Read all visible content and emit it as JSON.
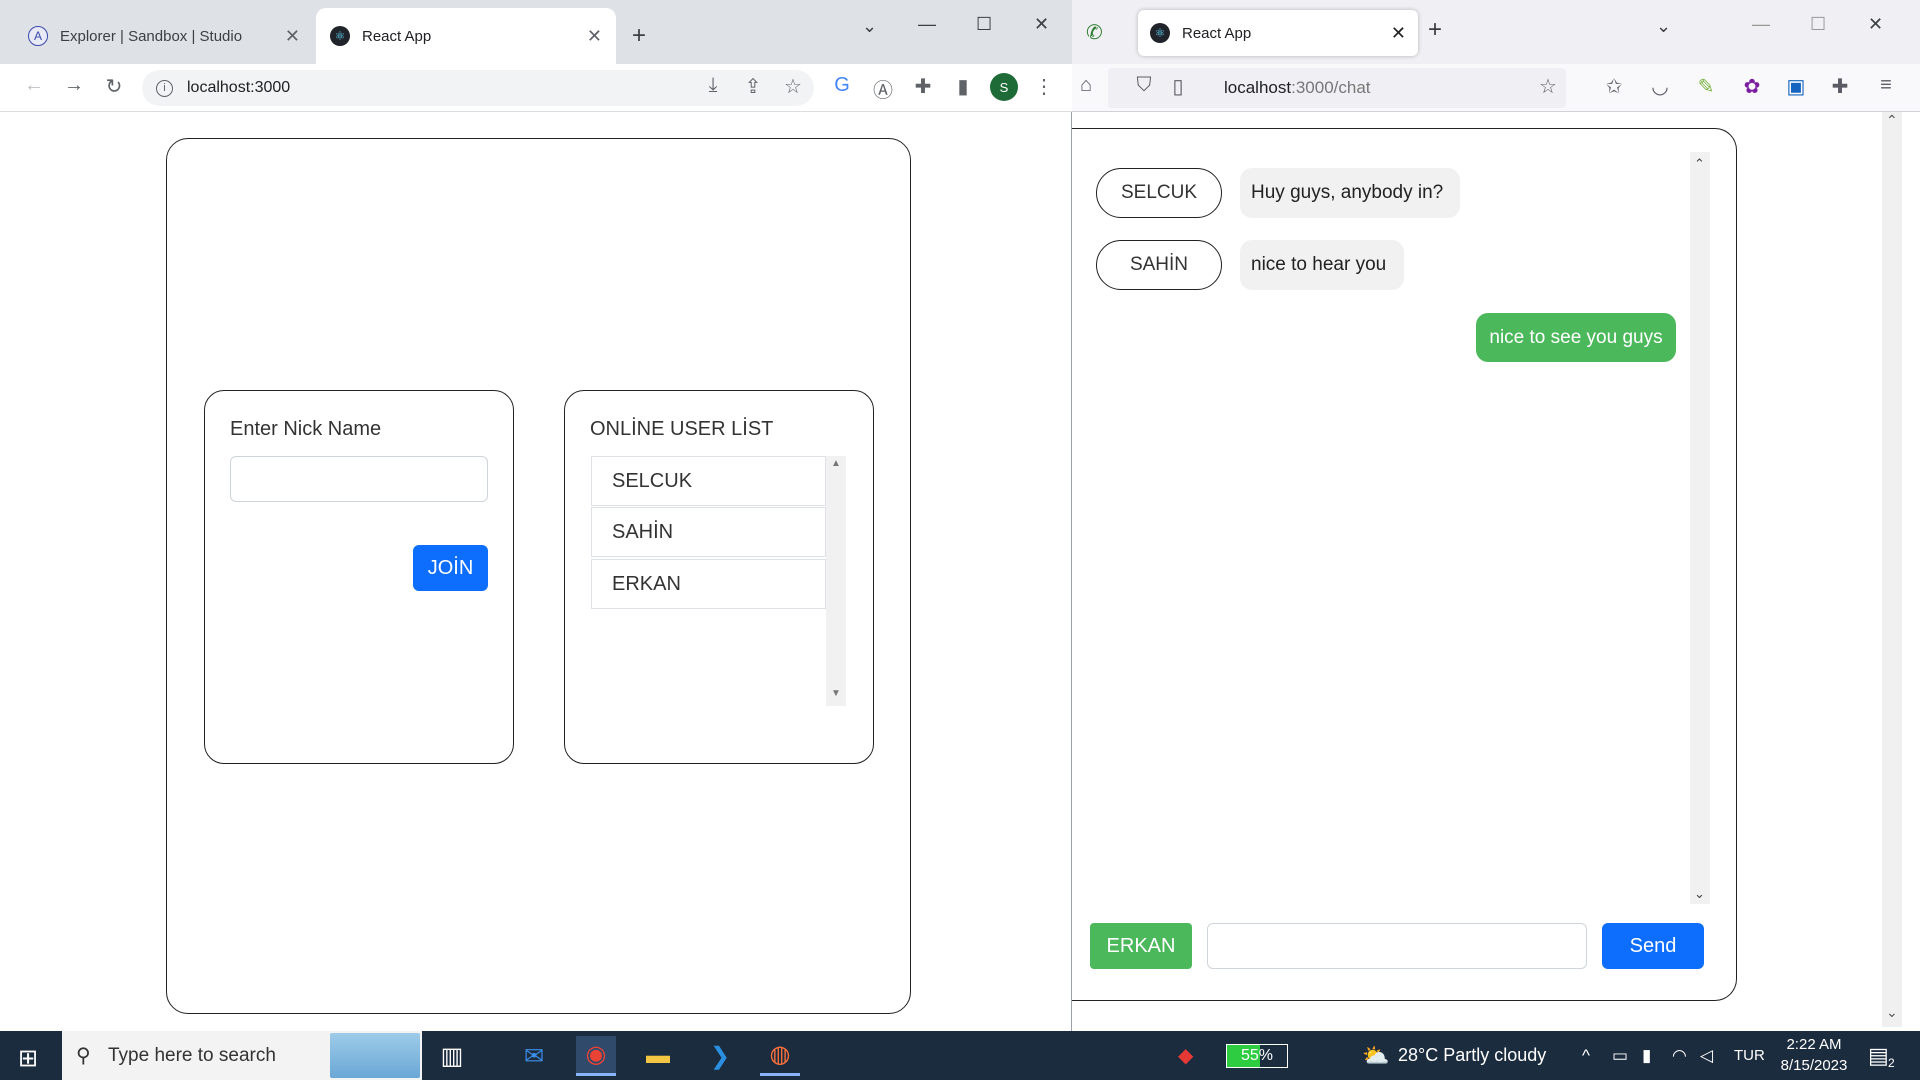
{
  "chrome": {
    "tabs": [
      {
        "label": "Explorer | Sandbox | Studio",
        "favicon": "A"
      },
      {
        "label": "React App"
      }
    ],
    "new_tab": "+",
    "url": "localhost:3000",
    "profile_initial": "S"
  },
  "login": {
    "nick_label": "Enter Nick Name",
    "nick_value": "",
    "join_label": "JOİN",
    "online_title": "ONLİNE USER LİST",
    "users": [
      "SELCUK",
      "SAHİN",
      "ERKAN"
    ]
  },
  "firefox": {
    "tab_label": "React App",
    "url_host": "localhost",
    "url_path": ":3000/chat"
  },
  "chat": {
    "messages": [
      {
        "user": "SELCUK",
        "text": "Huy guys, anybody in?"
      },
      {
        "user": "SAHİN",
        "text": "nice to hear you"
      }
    ],
    "my_message": "nice to see you guys",
    "current_user": "ERKAN",
    "input_value": "",
    "send_label": "Send"
  },
  "taskbar": {
    "search_placeholder": "Type here to search",
    "battery": "55%",
    "weather": "28°C  Partly cloudy",
    "language": "TUR",
    "time": "2:22 AM",
    "date": "8/15/2023",
    "notifications": "2"
  },
  "colors": {
    "primary": "#0d6efd",
    "success": "#4cb85c",
    "taskbar": "#1c2c3f"
  }
}
